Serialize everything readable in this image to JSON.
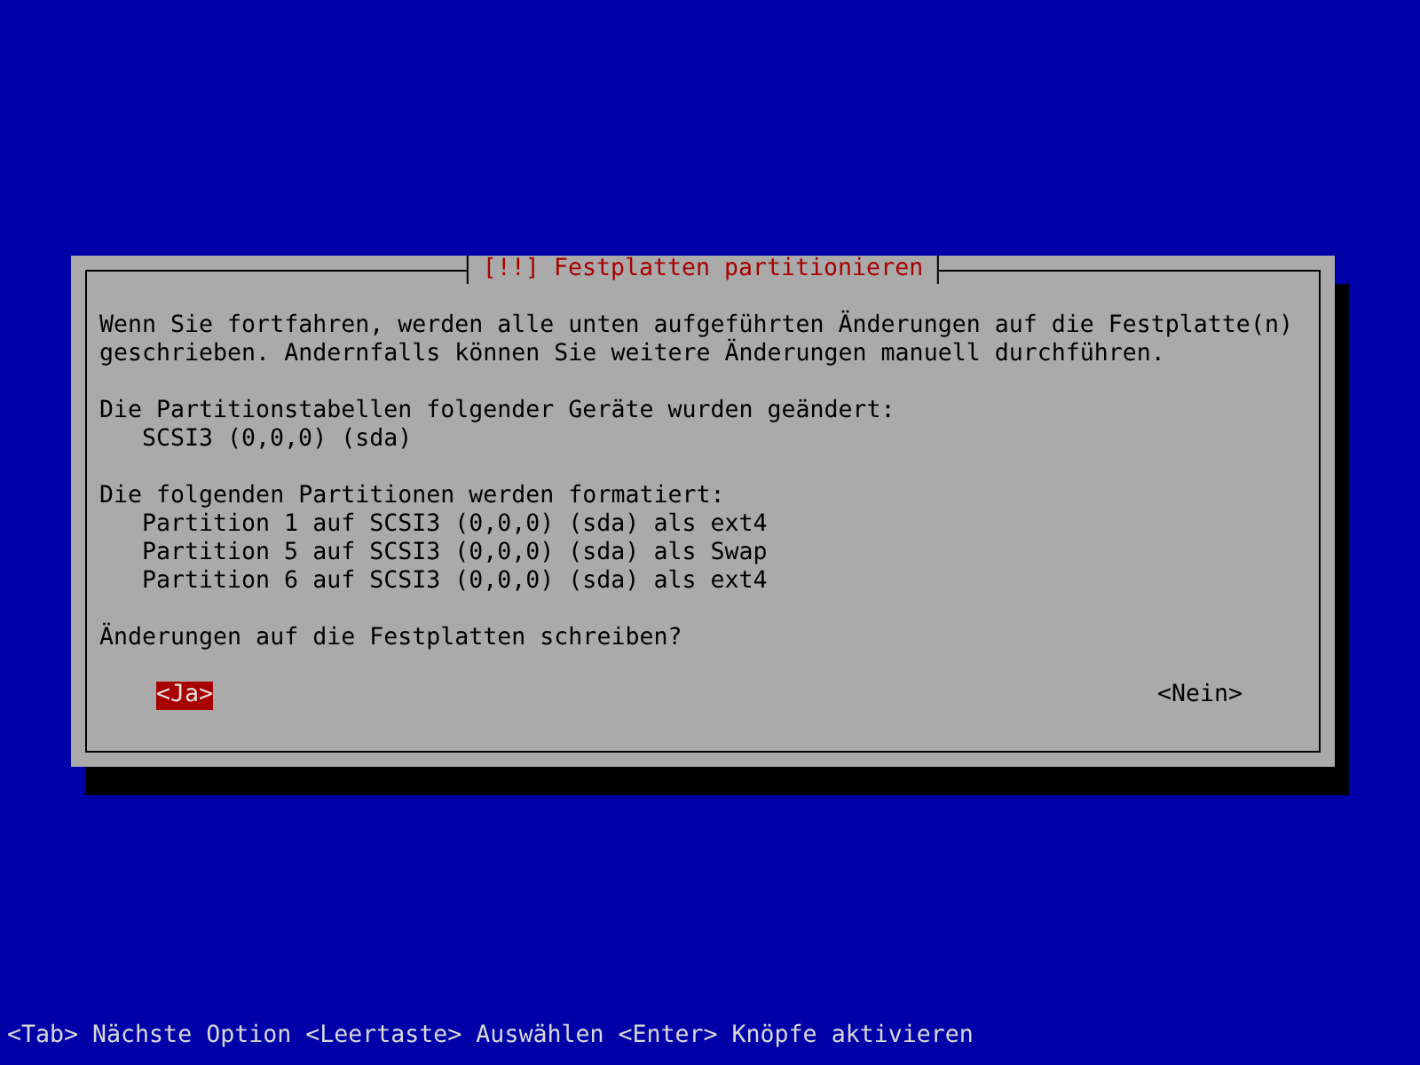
{
  "dialog": {
    "title": "[!!] Festplatten partitionieren",
    "intro": [
      "Wenn Sie fortfahren, werden alle unten aufgeführten Änderungen auf die Festplatte(n)",
      "geschrieben. Andernfalls können Sie weitere Änderungen manuell durchführen."
    ],
    "sections": [
      {
        "heading": "Die Partitionstabellen folgender Geräte wurden geändert:",
        "items": [
          "SCSI3 (0,0,0) (sda)"
        ]
      },
      {
        "heading": "Die folgenden Partitionen werden formatiert:",
        "items": [
          "Partition 1 auf SCSI3 (0,0,0) (sda) als ext4",
          "Partition 5 auf SCSI3 (0,0,0) (sda) als Swap",
          "Partition 6 auf SCSI3 (0,0,0) (sda) als ext4"
        ]
      }
    ],
    "question": "Änderungen auf die Festplatten schreiben?",
    "buttons": [
      {
        "label": "<Ja>",
        "selected": true
      },
      {
        "label": "<Nein>",
        "selected": false
      }
    ]
  },
  "status_bar": "<Tab> Nächste Option <Leertaste> Auswählen <Enter> Knöpfe aktivieren"
}
